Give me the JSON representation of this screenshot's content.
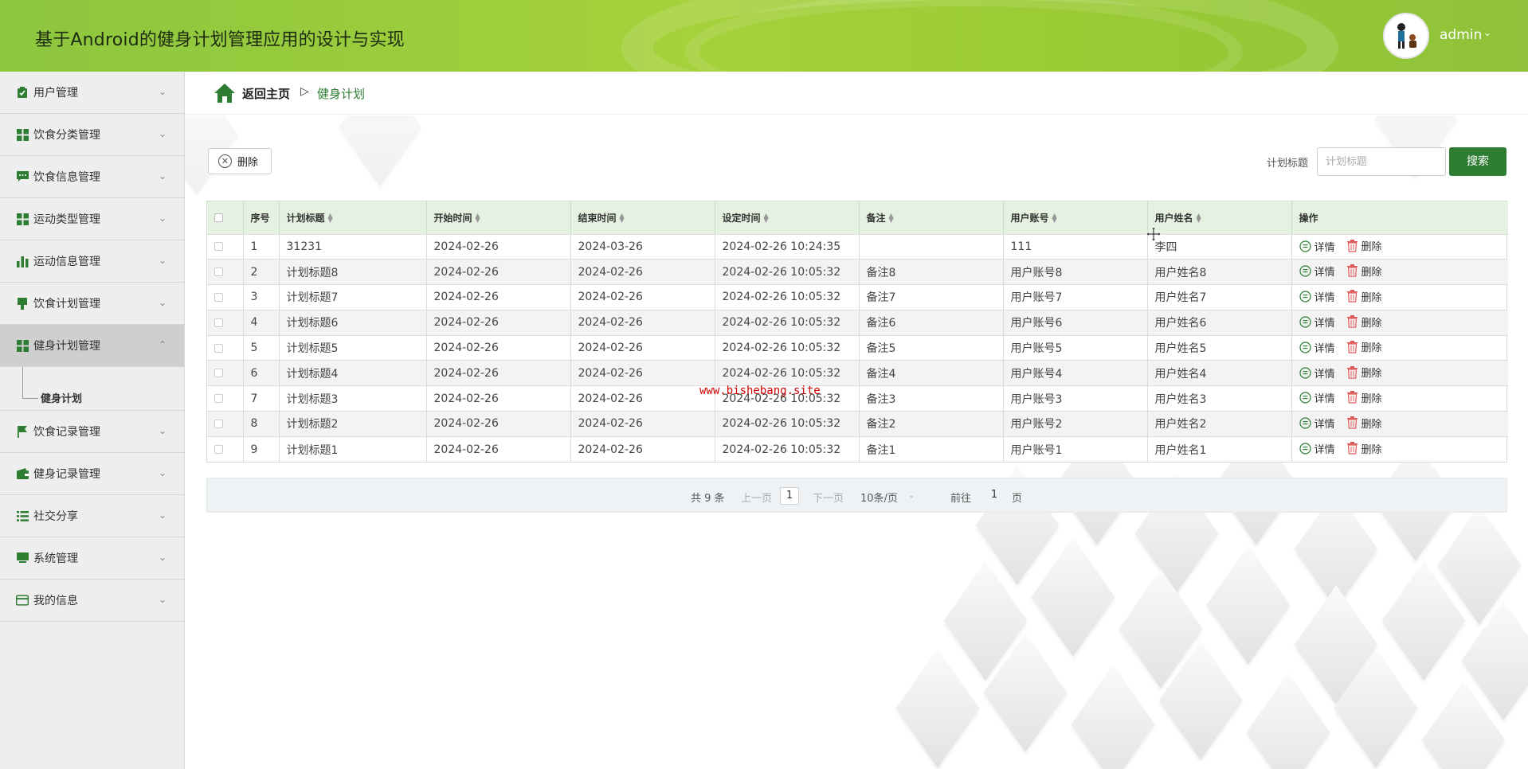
{
  "app": {
    "title": "基于Android的健身计划管理应用的设计与实现",
    "user": "admin"
  },
  "colors": {
    "header_green": "#8cc63f",
    "primary_green": "#2e7d32",
    "table_header_bg": "#e6f2e1",
    "delete_red": "#e25757"
  },
  "sidebar": {
    "items": [
      {
        "label": "用户管理",
        "icon": "clipboard-check-icon"
      },
      {
        "label": "饮食分类管理",
        "icon": "grid-icon"
      },
      {
        "label": "饮食信息管理",
        "icon": "chat-icon"
      },
      {
        "label": "运动类型管理",
        "icon": "grid-icon"
      },
      {
        "label": "运动信息管理",
        "icon": "bar-chart-icon"
      },
      {
        "label": "饮食计划管理",
        "icon": "cup-icon"
      },
      {
        "label": "健身计划管理",
        "icon": "grid-icon"
      },
      {
        "label": "饮食记录管理",
        "icon": "flag-icon"
      },
      {
        "label": "健身记录管理",
        "icon": "wallet-icon"
      },
      {
        "label": "社交分享",
        "icon": "list-icon"
      },
      {
        "label": "系统管理",
        "icon": "monitor-icon"
      },
      {
        "label": "我的信息",
        "icon": "card-icon"
      }
    ],
    "submenu_label": "健身计划"
  },
  "breadcrumb": {
    "home": "返回主页",
    "separator": "▷",
    "current": "健身计划"
  },
  "toolbar": {
    "delete_label": "删除",
    "search_label": "计划标题",
    "search_placeholder": "计划标题",
    "search_button": "搜索"
  },
  "table": {
    "columns": [
      "序号",
      "计划标题",
      "开始时间",
      "结束时间",
      "设定时间",
      "备注",
      "用户账号",
      "用户姓名",
      "操作"
    ],
    "rows": [
      {
        "no": "1",
        "title": "31231",
        "start": "2024-02-26",
        "end": "2024-03-26",
        "set": "2024-02-26 10:24:35",
        "note": "",
        "account": "111",
        "name": "李四"
      },
      {
        "no": "2",
        "title": "计划标题8",
        "start": "2024-02-26",
        "end": "2024-02-26",
        "set": "2024-02-26 10:05:32",
        "note": "备注8",
        "account": "用户账号8",
        "name": "用户姓名8"
      },
      {
        "no": "3",
        "title": "计划标题7",
        "start": "2024-02-26",
        "end": "2024-02-26",
        "set": "2024-02-26 10:05:32",
        "note": "备注7",
        "account": "用户账号7",
        "name": "用户姓名7"
      },
      {
        "no": "4",
        "title": "计划标题6",
        "start": "2024-02-26",
        "end": "2024-02-26",
        "set": "2024-02-26 10:05:32",
        "note": "备注6",
        "account": "用户账号6",
        "name": "用户姓名6"
      },
      {
        "no": "5",
        "title": "计划标题5",
        "start": "2024-02-26",
        "end": "2024-02-26",
        "set": "2024-02-26 10:05:32",
        "note": "备注5",
        "account": "用户账号5",
        "name": "用户姓名5"
      },
      {
        "no": "6",
        "title": "计划标题4",
        "start": "2024-02-26",
        "end": "2024-02-26",
        "set": "2024-02-26 10:05:32",
        "note": "备注4",
        "account": "用户账号4",
        "name": "用户姓名4"
      },
      {
        "no": "7",
        "title": "计划标题3",
        "start": "2024-02-26",
        "end": "2024-02-26",
        "set": "2024-02-26 10:05:32",
        "note": "备注3",
        "account": "用户账号3",
        "name": "用户姓名3"
      },
      {
        "no": "8",
        "title": "计划标题2",
        "start": "2024-02-26",
        "end": "2024-02-26",
        "set": "2024-02-26 10:05:32",
        "note": "备注2",
        "account": "用户账号2",
        "name": "用户姓名2"
      },
      {
        "no": "9",
        "title": "计划标题1",
        "start": "2024-02-26",
        "end": "2024-02-26",
        "set": "2024-02-26 10:05:32",
        "note": "备注1",
        "account": "用户账号1",
        "name": "用户姓名1"
      }
    ],
    "detail_label": "详情",
    "delete_label": "删除"
  },
  "pagination": {
    "total": "共 9 条",
    "prev": "上一页",
    "page": "1",
    "next": "下一页",
    "page_size": "10条/页",
    "goto_prefix": "前往",
    "goto_value": "1",
    "goto_suffix": "页"
  },
  "watermark": "www.bishebang.site"
}
